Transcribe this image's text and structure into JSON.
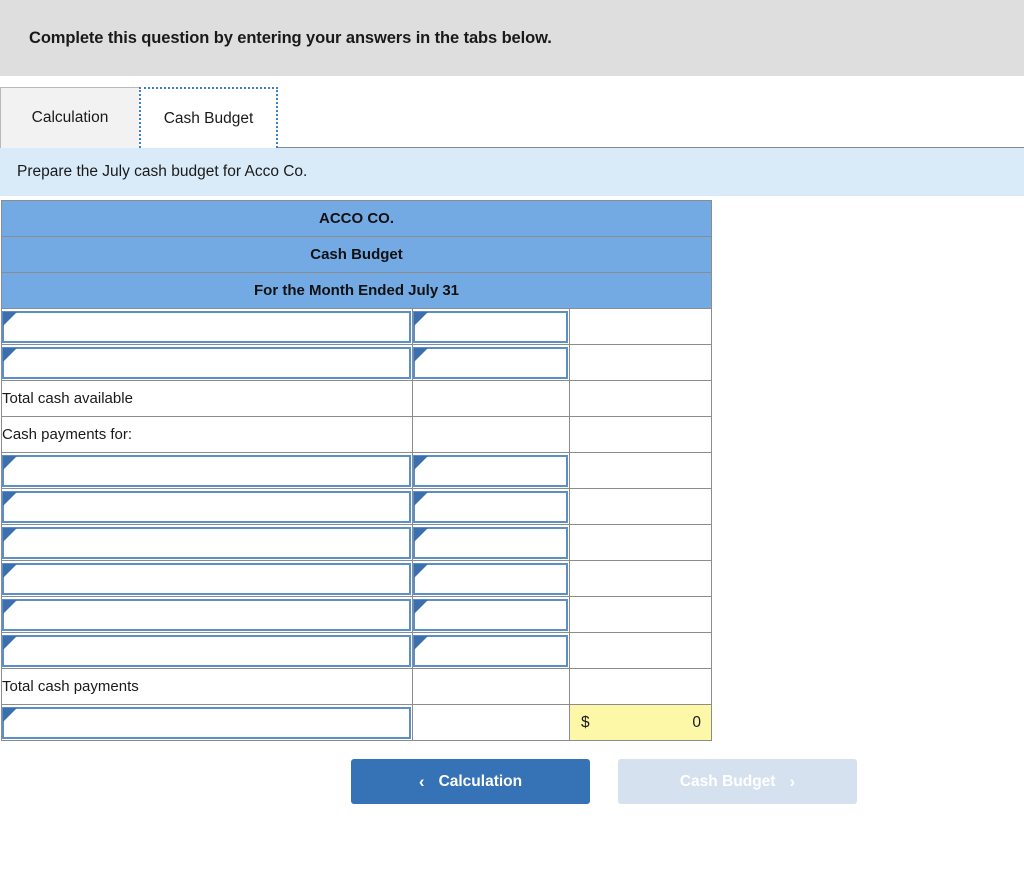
{
  "instruction": {
    "text": "Complete this question by entering your answers in the tabs below."
  },
  "tabs": [
    {
      "label": "Calculation",
      "active": false
    },
    {
      "label": "Cash Budget",
      "active": true
    }
  ],
  "requirement": {
    "text": "Prepare the July cash budget for Acco Co."
  },
  "worksheet": {
    "titles": [
      "ACCO CO.",
      "Cash Budget",
      "For the Month Ended July 31"
    ],
    "rows": [
      {
        "kind": "input",
        "label": "",
        "amount": "",
        "total": ""
      },
      {
        "kind": "input",
        "label": "",
        "amount": "",
        "total": "",
        "subtotal_rule": true
      },
      {
        "kind": "static",
        "label": "Total cash available",
        "amount": "",
        "total": ""
      },
      {
        "kind": "static",
        "label": "Cash payments for:",
        "amount": "",
        "total": ""
      },
      {
        "kind": "input",
        "label": "",
        "amount": "",
        "total": ""
      },
      {
        "kind": "input",
        "label": "",
        "amount": "",
        "total": ""
      },
      {
        "kind": "input",
        "label": "",
        "amount": "",
        "total": ""
      },
      {
        "kind": "input",
        "label": "",
        "amount": "",
        "total": ""
      },
      {
        "kind": "input",
        "label": "",
        "amount": "",
        "total": ""
      },
      {
        "kind": "input",
        "label": "",
        "amount": "",
        "total": "",
        "subtotal_rule": true
      },
      {
        "kind": "static",
        "label": "Total cash payments",
        "amount": "",
        "total": ""
      },
      {
        "kind": "final",
        "label": "",
        "amount": "",
        "currency": "$",
        "total": "0"
      }
    ]
  },
  "navigation": {
    "prev": {
      "label": "Calculation",
      "chevron": "‹",
      "enabled": true
    },
    "next": {
      "label": "Cash Budget",
      "chevron": "›",
      "enabled": false
    }
  },
  "colors": {
    "banner_bg": "#dedede",
    "requirement_bg": "#d9eaf8",
    "table_header_bg": "#74aae4",
    "input_border": "#5a8fc8",
    "flag": "#3b6fae",
    "yellow_cell": "#fcf8a8",
    "button_active": "#3572b6",
    "button_disabled": "#d6e1f0"
  }
}
